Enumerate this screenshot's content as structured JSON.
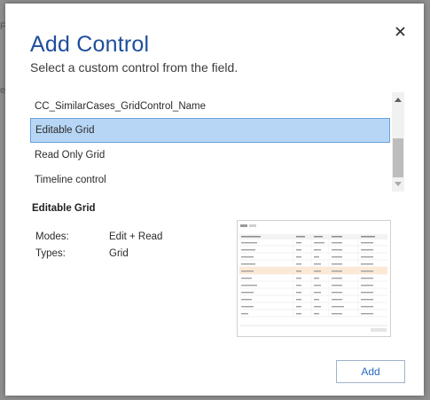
{
  "dialog": {
    "title": "Add Control",
    "subtitle": "Select a custom control from the field.",
    "close_label": "×"
  },
  "controls": [
    {
      "label": "CC_SimilarCases_GridControl_Name",
      "selected": false
    },
    {
      "label": "Editable Grid",
      "selected": true
    },
    {
      "label": "Read Only Grid",
      "selected": false
    },
    {
      "label": "Timeline control",
      "selected": false
    }
  ],
  "details": {
    "title": "Editable Grid",
    "modes_label": "Modes:",
    "modes_value": "Edit + Read",
    "types_label": "Types:",
    "types_value": "Grid"
  },
  "add_button": "Add",
  "colors": {
    "accent": "#1f4e9c",
    "selection_bg": "#b7d6f5",
    "selection_border": "#6aa3dc"
  }
}
